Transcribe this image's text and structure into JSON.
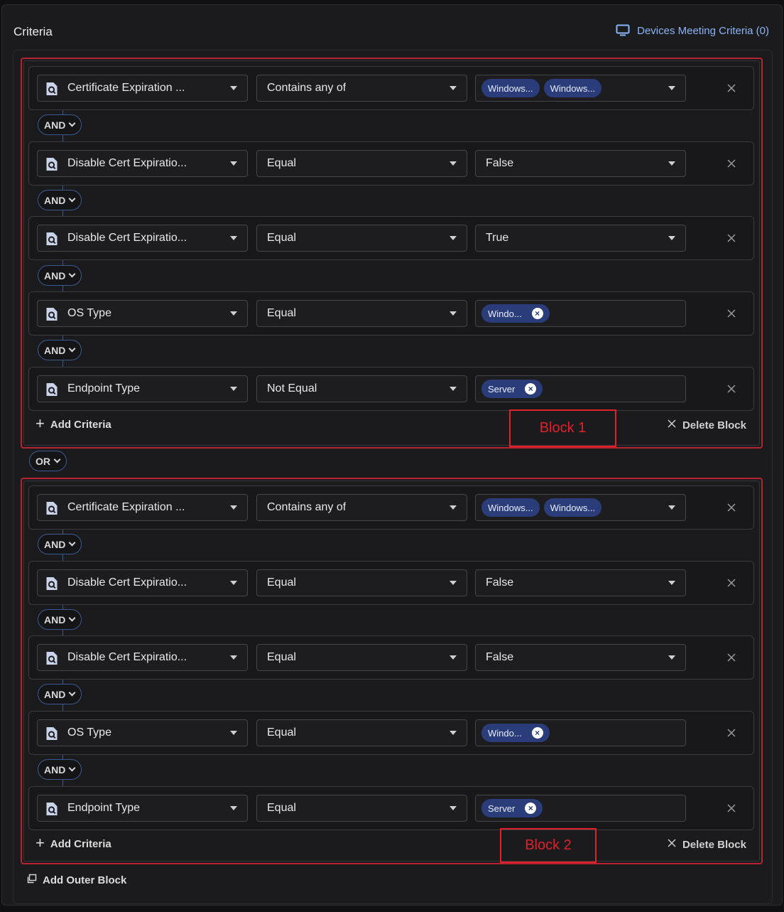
{
  "header": {
    "title": "Criteria",
    "devices_link": "Devices Meeting Criteria (0)"
  },
  "blocks": [
    {
      "annotation": "Block 1",
      "rows": [
        {
          "field": "Certificate Expiration ...",
          "operator": "Contains any of",
          "value": "",
          "chips": [
            "Windows...",
            "Windows..."
          ],
          "chip_removable": false,
          "value_dropdown": true
        },
        {
          "field": "Disable Cert Expiratio...",
          "operator": "Equal",
          "value": "False",
          "chips": [],
          "value_dropdown": true
        },
        {
          "field": "Disable Cert Expiratio...",
          "operator": "Equal",
          "value": "True",
          "chips": [],
          "value_dropdown": true
        },
        {
          "field": "OS Type",
          "operator": "Equal",
          "value": "",
          "chips": [
            "Windo..."
          ],
          "chip_removable": true,
          "value_dropdown": false
        },
        {
          "field": "Endpoint Type",
          "operator": "Not Equal",
          "value": "",
          "chips": [
            "Server"
          ],
          "chip_removable": true,
          "value_dropdown": false
        }
      ],
      "connectors": [
        "AND",
        "AND",
        "AND",
        "AND"
      ],
      "add_criteria": "Add Criteria",
      "delete_block": "Delete Block"
    },
    {
      "annotation": "Block 2",
      "rows": [
        {
          "field": "Certificate Expiration ...",
          "operator": "Contains any of",
          "value": "",
          "chips": [
            "Windows...",
            "Windows..."
          ],
          "chip_removable": false,
          "value_dropdown": true
        },
        {
          "field": "Disable Cert Expiratio...",
          "operator": "Equal",
          "value": "False",
          "chips": [],
          "value_dropdown": true
        },
        {
          "field": "Disable Cert Expiratio...",
          "operator": "Equal",
          "value": "False",
          "chips": [],
          "value_dropdown": true
        },
        {
          "field": "OS Type",
          "operator": "Equal",
          "value": "",
          "chips": [
            "Windo..."
          ],
          "chip_removable": true,
          "value_dropdown": false
        },
        {
          "field": "Endpoint Type",
          "operator": "Equal",
          "value": "",
          "chips": [
            "Server"
          ],
          "chip_removable": true,
          "value_dropdown": false
        }
      ],
      "connectors": [
        "AND",
        "AND",
        "AND",
        "AND"
      ],
      "add_criteria": "Add Criteria",
      "delete_block": "Delete Block"
    }
  ],
  "outer_connector": "OR",
  "add_outer_block": "Add Outer Block",
  "colors": {
    "background": "#1b1b1d",
    "accent_link": "#8ab4f8",
    "chip": "#2a3d7a",
    "annotation_red": "#e0202a"
  },
  "icons": {
    "devices": "monitor-icon",
    "field": "search-doc-icon",
    "remove": "close-icon",
    "add": "plus-icon",
    "outer": "add-block-icon"
  }
}
